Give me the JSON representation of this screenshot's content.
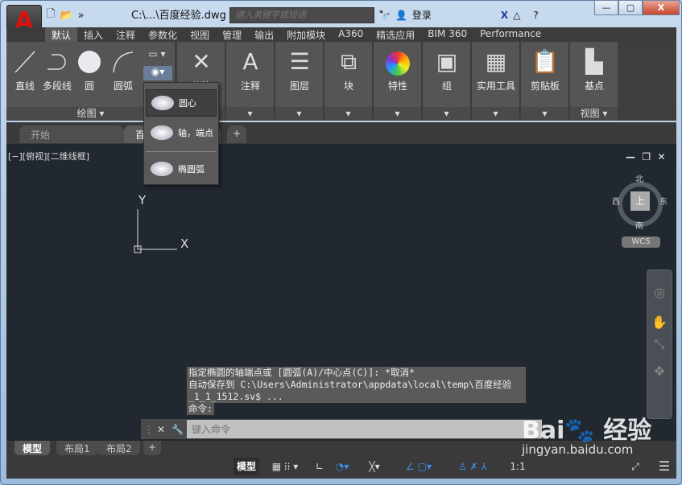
{
  "app": {
    "logo": "A",
    "title": "C:\\...\\百度经验.dwg",
    "search_placeholder": "键入关键字或短语",
    "login": "登录",
    "window_controls": [
      "minimize",
      "maximize",
      "close"
    ]
  },
  "ribbon_tabs": [
    {
      "label": "默认",
      "active": true
    },
    {
      "label": "插入"
    },
    {
      "label": "注释"
    },
    {
      "label": "参数化"
    },
    {
      "label": "视图"
    },
    {
      "label": "管理"
    },
    {
      "label": "输出"
    },
    {
      "label": "附加模块"
    },
    {
      "label": "A360"
    },
    {
      "label": "精选应用"
    },
    {
      "label": "BIM 360"
    },
    {
      "label": "Performance"
    }
  ],
  "draw_panel": {
    "title": "绘图 ▾",
    "tools": [
      "直线",
      "多段线",
      "圆",
      "圆弧"
    ]
  },
  "panels": [
    {
      "label": "修改"
    },
    {
      "label": "注释"
    },
    {
      "label": "图层"
    },
    {
      "label": "块"
    },
    {
      "label": "特性"
    },
    {
      "label": "组"
    },
    {
      "label": "实用工具"
    },
    {
      "label": "剪贴板"
    },
    {
      "label": "基点",
      "title": "视图 ▾"
    }
  ],
  "ellipse_dropdown": {
    "items": [
      {
        "label": "圆心",
        "highlighted": true
      },
      {
        "label": "轴，端点"
      },
      {
        "label": "椭圆弧"
      }
    ]
  },
  "file_tabs": [
    {
      "label": "开始"
    },
    {
      "label": "百度经验",
      "active": true
    },
    {
      "label": "+"
    }
  ],
  "viewport_label": "[−][俯视][二维线框]",
  "ucs": {
    "x": "X",
    "y": "Y"
  },
  "viewcube": {
    "top": "上",
    "north": "北",
    "south": "南",
    "east": "东",
    "west": "西",
    "wcs": "WCS"
  },
  "command_history": [
    "指定椭圆的轴端点或 [圆弧(A)/中心点(C)]: *取消*",
    "自动保存到 C:\\Users\\Administrator\\appdata\\local\\temp\\百度经验",
    "_1_1_1512.sv$ ...",
    "命令:"
  ],
  "command_input_placeholder": "键入命令",
  "layout_tabs": [
    {
      "label": "模型",
      "active": true
    },
    {
      "label": "布局1"
    },
    {
      "label": "布局2"
    },
    {
      "label": "+"
    }
  ],
  "status_bar": {
    "model": "模型",
    "scale": "1:1"
  },
  "watermark": {
    "text": "Bai du 经验",
    "url": "jingyan.baidu.com"
  }
}
